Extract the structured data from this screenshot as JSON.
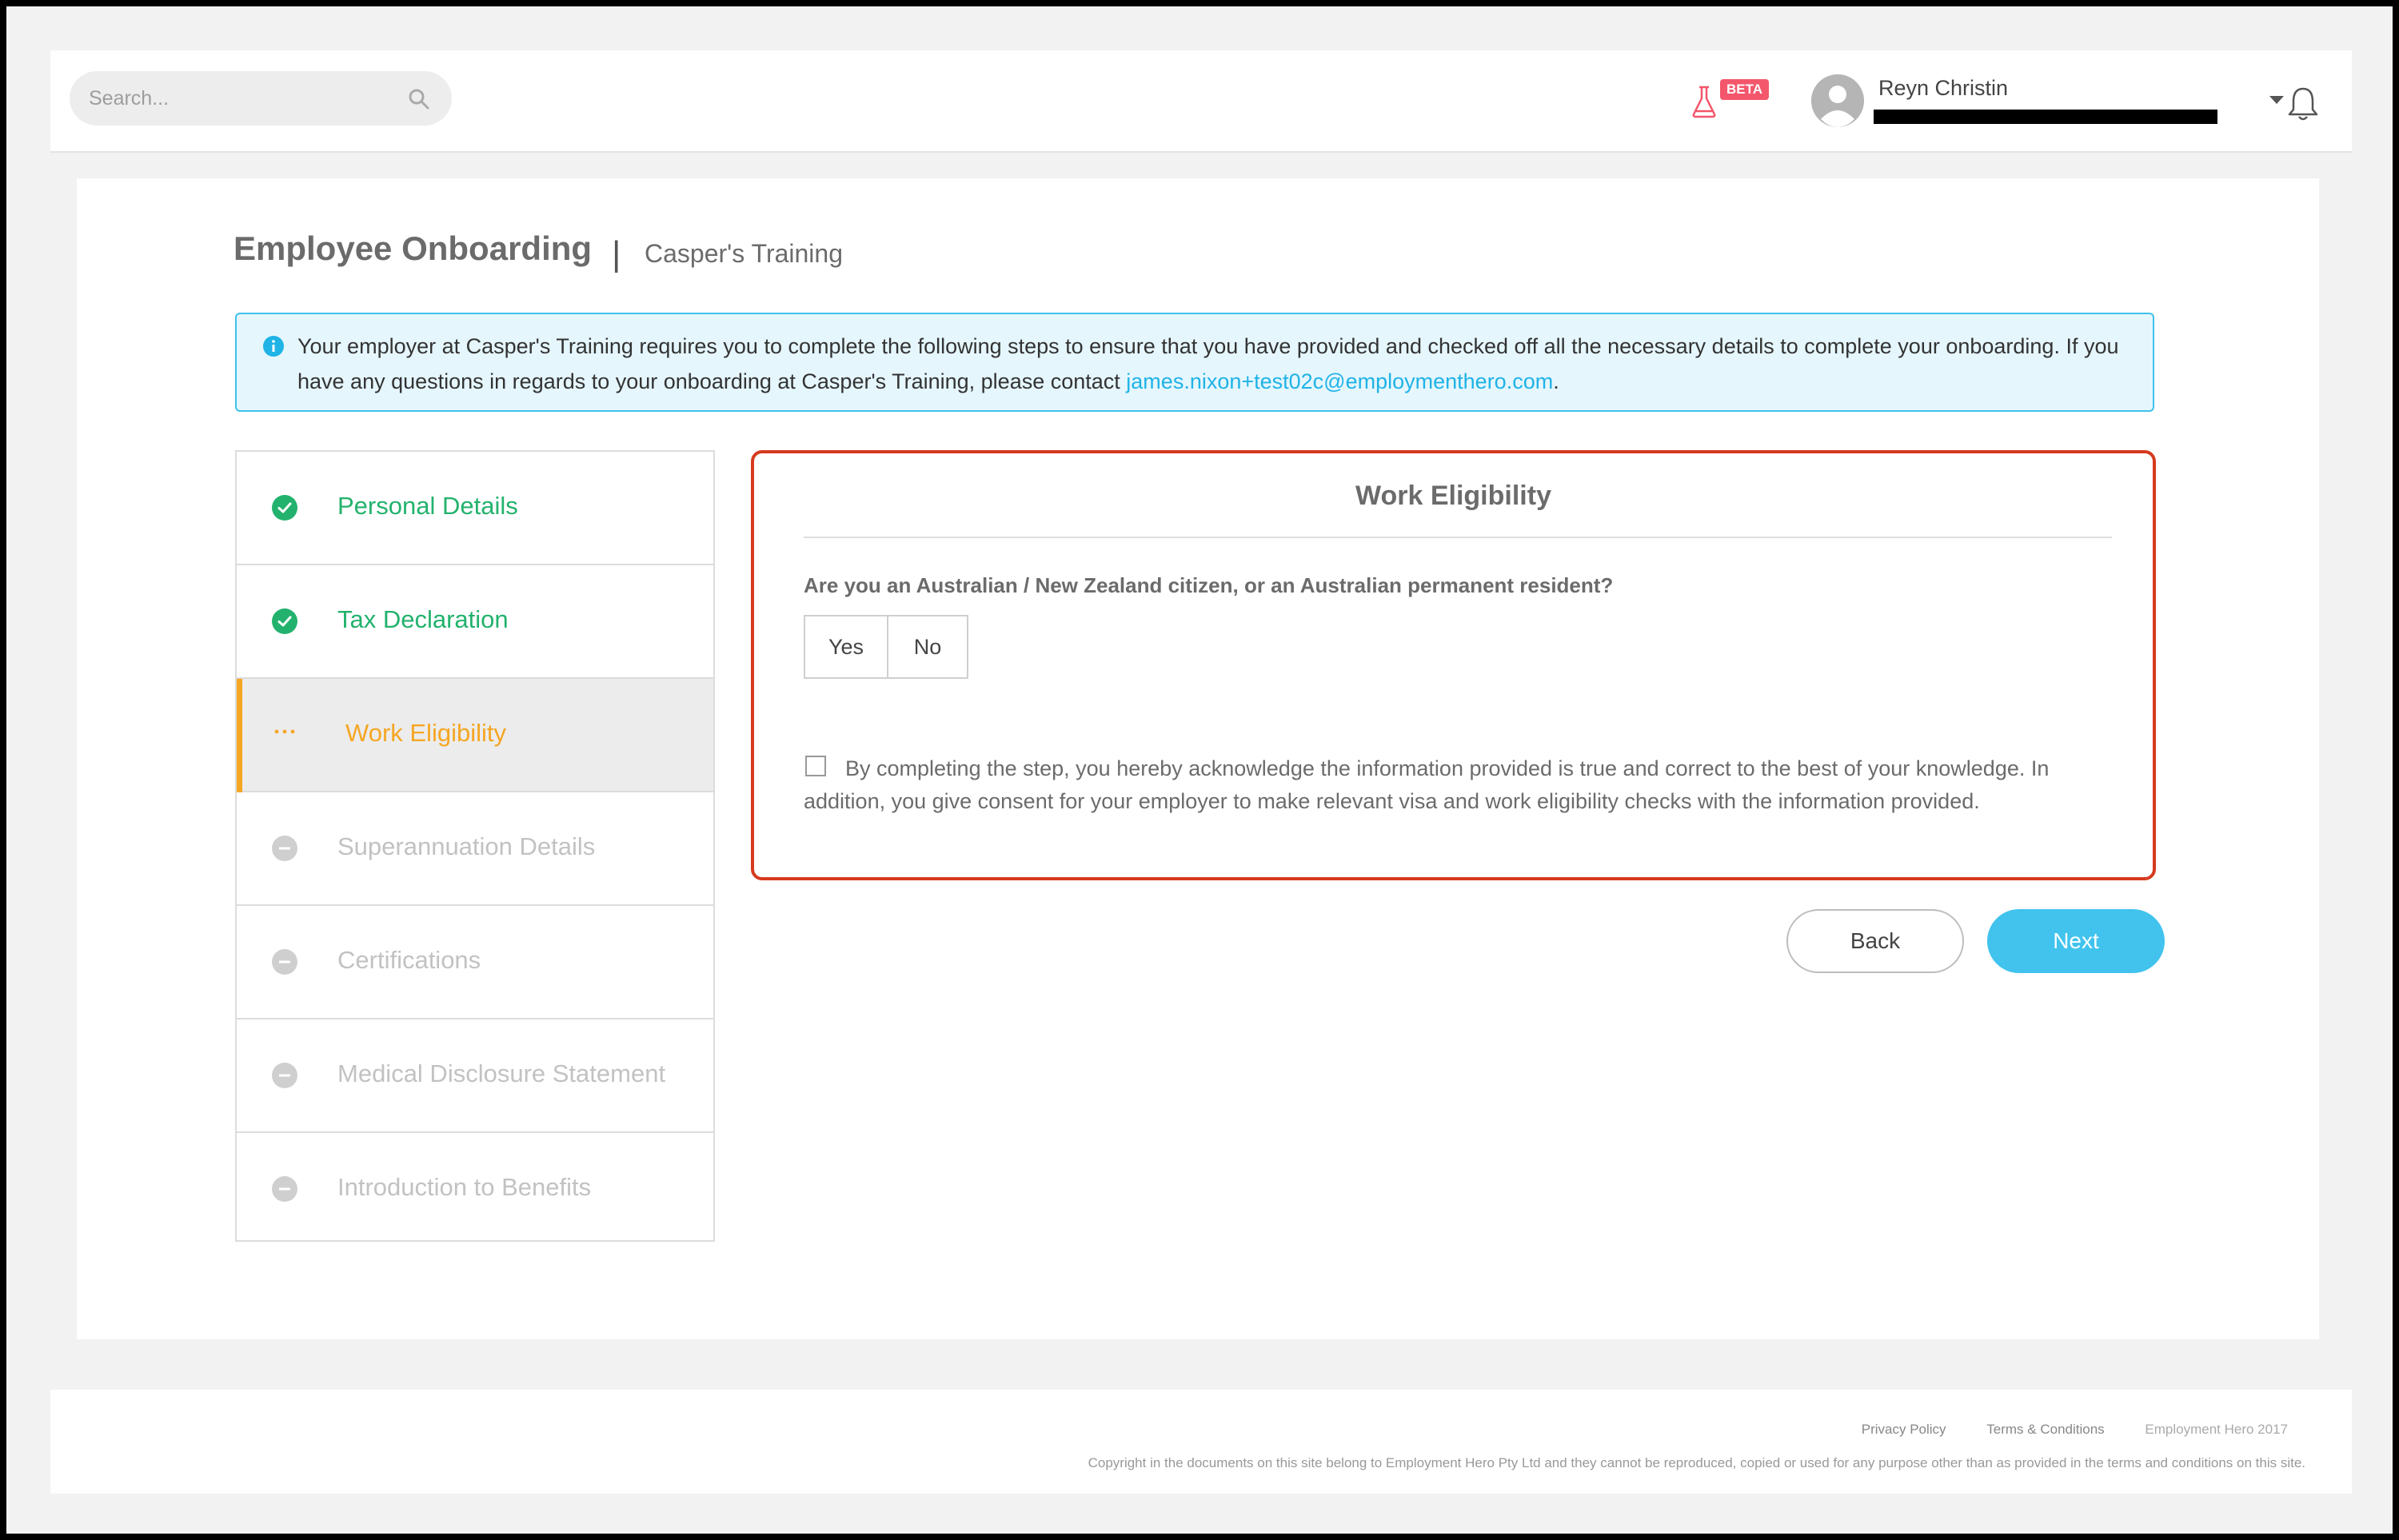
{
  "header": {
    "search_placeholder": "Search...",
    "beta_label": "BETA",
    "user_name": "Reyn Christin"
  },
  "page": {
    "title": "Employee Onboarding",
    "separator": "|",
    "company": "Casper's Training"
  },
  "info": {
    "text": "Your employer at Casper's Training requires you to complete the following steps to ensure that you have provided and checked off all the necessary details to complete your onboarding. If you have any questions in regards to your onboarding at Casper's Training, please contact ",
    "email": "james.nixon+test02c@employmenthero.com",
    "suffix": "."
  },
  "steps": [
    {
      "label": "Personal Details",
      "status": "done"
    },
    {
      "label": "Tax Declaration",
      "status": "done"
    },
    {
      "label": "Work Eligibility",
      "status": "active"
    },
    {
      "label": "Superannuation Details",
      "status": "pending"
    },
    {
      "label": "Certifications",
      "status": "pending"
    },
    {
      "label": "Medical Disclosure Statement",
      "status": "pending"
    },
    {
      "label": "Introduction to Benefits",
      "status": "pending"
    }
  ],
  "panel": {
    "title": "Work Eligibility",
    "question": "Are you an Australian / New Zealand citizen, or an Australian permanent resident?",
    "yes_label": "Yes",
    "no_label": "No",
    "consent": "By completing the step, you hereby acknowledge the information provided is true and correct to the best of your knowledge. In addition, you give consent for your employer to make relevant visa and work eligibility checks with the information provided."
  },
  "actions": {
    "back_label": "Back",
    "next_label": "Next"
  },
  "footer": {
    "privacy": "Privacy Policy",
    "terms": "Terms & Conditions",
    "brand": "Employment Hero 2017",
    "copyright": "Copyright in the documents on this site belong to Employment Hero Pty Ltd and they cannot be reproduced, copied or used for any purpose other than as provided in the terms and conditions on this site."
  },
  "colors": {
    "done": "#23b26d",
    "active": "#f5a623",
    "pending": "#c2c2c2",
    "accent": "#41c3ee",
    "highlight_border": "#d63a1f"
  }
}
